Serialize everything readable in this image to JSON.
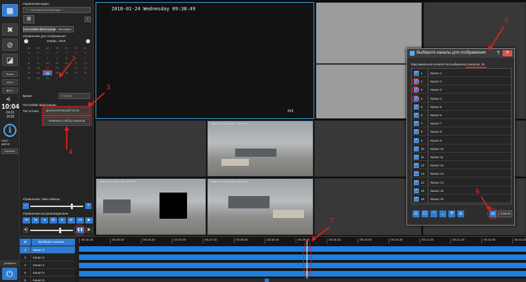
{
  "toolbar": {
    "clock_time": "10:04",
    "clock_date": "24.01",
    "clock_year": "2018",
    "user_label": "User -",
    "user_name": "admin",
    "change_label": "Сменить",
    "add_label": "Добавить",
    "small_btn_1": "Видео",
    "small_btn_2": "●Вкл",
    "small_btn_3": "■Вкл"
  },
  "panel": {
    "video_control_title": "Управление видео",
    "layout_field": "---- Автоматический вид ----",
    "layout_num": "1",
    "tab_playback": "Настройки фильтрации",
    "tab_bookmarks": "Закладки",
    "playback_title": "Управление для отображения",
    "month_label": "январь, 2018",
    "weekdays": [
      "пн",
      "вт",
      "ср",
      "чт",
      "пт",
      "сб",
      "вс"
    ],
    "calendar": [
      [
        "25",
        "26",
        "27",
        "28",
        "29",
        "30",
        "31"
      ],
      [
        "1",
        "2",
        "3",
        "4",
        "5",
        "6",
        "7"
      ],
      [
        "8",
        "9",
        "10",
        "11",
        "12",
        "13",
        "14"
      ],
      [
        "15",
        "16",
        "17",
        "18",
        "19",
        "20",
        "21"
      ],
      [
        "22",
        "23",
        "24",
        "25",
        "26",
        "27",
        "28"
      ],
      [
        "29",
        "30",
        "31",
        "1",
        "2",
        "3",
        "4"
      ]
    ],
    "selected_day": "24",
    "time_label": "Время",
    "time_value": "9:35:25",
    "filter_title": "Настройки фильтрации",
    "stream_label": "Тип потока:",
    "stream_value": "Дополнительный поток",
    "channels_button": "Изменить набор каналов",
    "tile_control_title": "Управление тайм-лайном",
    "playback_ctrl_title": "Управление воспроизведением",
    "speed_label": "x1"
  },
  "video": {
    "osd_timestamp": "2018-01-24 Wednesday 09:38:49",
    "osd_channel": "XVI",
    "office_stamps": [
      "2018-01-24 Wednesday 09:38:49",
      "2018-01-24 Wednesday 09:38:49",
      "2018-01-24 Wednesday 09:38:49"
    ]
  },
  "dialog": {
    "title": "Выберите каналы для отображения",
    "help": "?",
    "close": "✕",
    "max_label": "Максимальное количество выбранных каналов: 16",
    "channels": [
      {
        "num": "1",
        "name": "Канал 1"
      },
      {
        "num": "2",
        "name": "Канал 2"
      },
      {
        "num": "3",
        "name": "Канал 3"
      },
      {
        "num": "4",
        "name": "Канал 4"
      },
      {
        "num": "5",
        "name": "Канал 5"
      },
      {
        "num": "6",
        "name": "Канал 6"
      },
      {
        "num": "7",
        "name": "Канал 7"
      },
      {
        "num": "8",
        "name": "Канал 8"
      },
      {
        "num": "9",
        "name": "Канал 9"
      },
      {
        "num": "10",
        "name": "Канал 10"
      },
      {
        "num": "11",
        "name": "Канал 11"
      },
      {
        "num": "12",
        "name": "Канал 12"
      },
      {
        "num": "13",
        "name": "Канал 13"
      },
      {
        "num": "14",
        "name": "Канал 14"
      },
      {
        "num": "15",
        "name": "Канал 15"
      },
      {
        "num": "16",
        "name": "Канал 16"
      }
    ],
    "ok_label": "OK",
    "cancel_label": "Cancel"
  },
  "annotations": [
    "2",
    "3",
    "4",
    "5",
    "6",
    "7"
  ],
  "timeline": {
    "table_id_header": "ID",
    "table_name_header": "Выберите каналы",
    "rows": [
      {
        "id": "2",
        "name": "Канал 2"
      },
      {
        "id": "3",
        "name": "Канал 3"
      },
      {
        "id": "4",
        "name": "Канал 4"
      },
      {
        "id": "5",
        "name": "Канал 5"
      },
      {
        "id": "6",
        "name": "Канал 6"
      }
    ],
    "ticks": [
      "09:35:30",
      "09:36:00",
      "09:36:30",
      "09:37:00",
      "09:37:30",
      "09:38:00",
      "09:38:30",
      "09:39:00",
      "09:39:30",
      "09:40:00",
      "09:40:30",
      "09:41:00",
      "09:41:30",
      "09:42:00",
      "09:42:30"
    ]
  },
  "colors": {
    "accent": "#2f7bd0",
    "annotation_red": "#e02020",
    "record_bar": "#1e7fe0",
    "selection_border": "#3aa3e0"
  }
}
